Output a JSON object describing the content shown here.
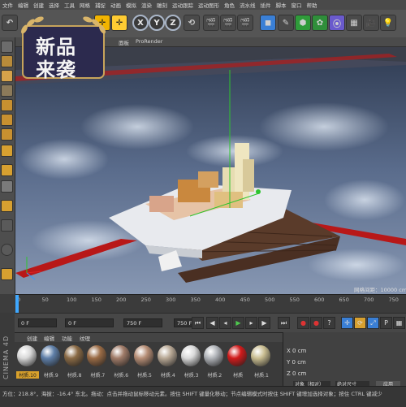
{
  "menu": [
    "文件",
    "编辑",
    "创建",
    "选择",
    "工具",
    "网格",
    "捕捉",
    "动画",
    "模拟",
    "渲染",
    "雕刻",
    "运动跟踪",
    "运动图形",
    "角色",
    "流水线",
    "插件",
    "脚本",
    "窗口",
    "帮助"
  ],
  "toolbar": {
    "x": "X",
    "y": "Y",
    "z": "Z"
  },
  "badge": {
    "line1": "新品",
    "line2": "来袭"
  },
  "viewport": {
    "menu_fragment": "面板",
    "renderer": "ProRender",
    "grid_info": "网格间距：10000 cm"
  },
  "timeline": {
    "ticks": [
      "0",
      "50",
      "100",
      "150",
      "200",
      "250",
      "300",
      "350",
      "400",
      "450",
      "500",
      "550",
      "600",
      "650",
      "700",
      "750"
    ],
    "end": "750",
    "current": "0 F"
  },
  "transport": {
    "start_frame": "0 F",
    "current_frame": "0 F",
    "end_frame": "750 F",
    "max_frame": "750 F"
  },
  "materials": {
    "tabs": [
      "创建",
      "编辑",
      "功能",
      "纹理"
    ],
    "items": [
      {
        "label": "材质.10",
        "color": "#d8d8d8"
      },
      {
        "label": "材质.9",
        "color": "#5f7fa8"
      },
      {
        "label": "材质.8",
        "color": "#8a6a45"
      },
      {
        "label": "材质.7",
        "color": "#9a6b45"
      },
      {
        "label": "材质.6",
        "color": "#a07b68"
      },
      {
        "label": "材质.5",
        "color": "#b58d75"
      },
      {
        "label": "材质.4",
        "color": "#b8a895"
      },
      {
        "label": "材质.3",
        "color": "#d9d9d9"
      },
      {
        "label": "材质.2",
        "color": "#b0b3b8"
      },
      {
        "label": "材质",
        "color": "#d11b1b"
      },
      {
        "label": "材质.1",
        "color": "#c9bd91"
      }
    ]
  },
  "coordinates": {
    "rows": [
      {
        "axis": "X",
        "value": "0 cm"
      },
      {
        "axis": "Y",
        "value": "0 cm"
      },
      {
        "axis": "Z",
        "value": "0 cm"
      }
    ],
    "mode": "对象（相对）",
    "size_mode": "绝对尺寸",
    "apply": "应用"
  },
  "branding": "CINEMA 4D",
  "status": "方位：218.8°，海拔：-16.4°  东北。拖动：点击并拖动鼠标移动元素。按住 SHIFT 键量化移动；节点编辑模式时按住 SHIFT 键增加选择对象；按住 CTRL 键减少"
}
